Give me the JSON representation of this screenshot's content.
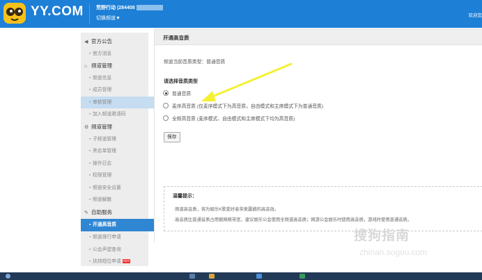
{
  "header": {
    "logo_text": "YY.COM",
    "channel_name": "荒野行动 (284408",
    "switch_channel": "切换频道▼",
    "welcome": "欢迎您"
  },
  "sidebar": {
    "groups": [
      {
        "icon": "speaker-icon",
        "label": "官方公告",
        "items": [
          "官方消息"
        ]
      },
      {
        "icon": "home-icon",
        "label": "频道管理",
        "items": [
          "频道信息",
          "成员管理",
          "审核管理",
          "加入频道邀请码"
        ]
      },
      {
        "icon": "gear-icon",
        "label": "频道管理",
        "items": [
          "子频道管理",
          "黑名单管理",
          "操作日志",
          "权限管理",
          "频道安全设置",
          "频道解散"
        ]
      },
      {
        "icon": "wrench-icon",
        "label": "自助服务",
        "items": [
          "开通高音质",
          "频道排行申请",
          "公会声望查询",
          "扶持短位申请"
        ]
      }
    ],
    "hot_badge": "HOT"
  },
  "main": {
    "title": "开通高音质",
    "current_type": "频道当前音质类型：普通音质",
    "choose_label": "请选择音质类型",
    "options": [
      "普通音质",
      "麦序高音质 (仅麦序模式下为高音质，自由模式和主席模式下为普通音质)",
      "全频高音质 (麦序模式、自由模式和主席模式下均为高音质)"
    ],
    "selected_option": 0,
    "save_label": "保存",
    "tips": {
      "title": "温馨提示：",
      "lines": [
        "·频道高音质，将为娱乐K歌爱好者带来震撼的高音效。",
        "·高音质比普通音质占用额网络带宽，建议娱乐公会使用全频道高音质；网游公会娱乐时使用高音质，游戏时使用普通音质。"
      ]
    }
  },
  "watermark": {
    "text": "搜狗指南",
    "url": "zhinan.sogou.com"
  },
  "colors": {
    "header_bg": "#1d7fd6",
    "active_item": "#2f86d2",
    "annotation_arrow": "#f5f032"
  }
}
